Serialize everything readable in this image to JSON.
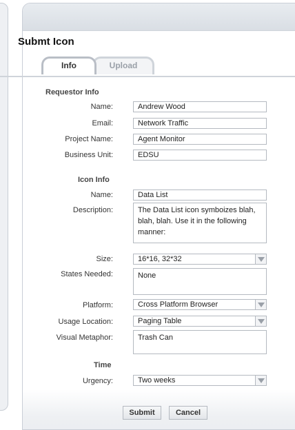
{
  "form": {
    "title": "Submt Icon",
    "tabs": [
      {
        "label": "Info"
      },
      {
        "label": "Upload"
      }
    ],
    "requestor": {
      "heading": "Requestor Info",
      "name_label": "Name:",
      "name_value": "Andrew Wood",
      "email_label": "Email:",
      "email_value": "Network Traffic",
      "project_label": "Project Name:",
      "project_value": "Agent Monitor",
      "business_label": "Business Unit:",
      "business_value": "EDSU"
    },
    "icon": {
      "heading": "Icon Info",
      "name_label": "Name:",
      "name_value": "Data List",
      "description_label": "Description:",
      "description_lines": [
        "The Data List icon symboizes blah,",
        "blah, blah. Use it in the following",
        "manner:"
      ],
      "size_label": "Size:",
      "size_value": "16*16, 32*32",
      "states_label": "States Needed:",
      "states_value": "None",
      "platform_label": "Platform:",
      "platform_value": "Cross Platform Browser",
      "usage_label": "Usage Location:",
      "usage_value": "Paging Table",
      "metaphor_label": "Visual Metaphor:",
      "metaphor_value": "Trash Can"
    },
    "time": {
      "heading": "Time",
      "urgency_label": "Urgency:",
      "urgency_value": "Two weeks"
    },
    "buttons": {
      "submit": "Submit",
      "cancel": "Cancel"
    }
  }
}
